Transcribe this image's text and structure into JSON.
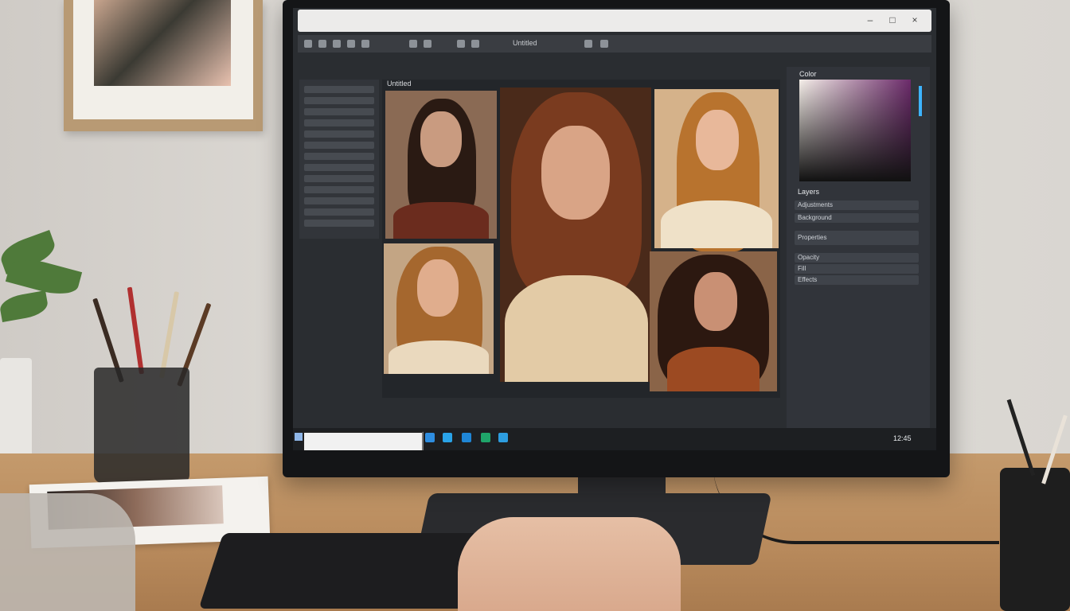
{
  "app": {
    "window_title": "",
    "toolbar_labels": [
      "Untitled"
    ],
    "tabs": [
      "Untitled"
    ]
  },
  "panels": {
    "color_panel_title": "Color",
    "layers_title": "Layers",
    "layer_rows": [
      "Adjustments",
      "Background",
      "Properties",
      "Opacity",
      "Fill",
      "Effects"
    ]
  },
  "taskbar": {
    "search_placeholder": "",
    "tray_text": "12:45"
  },
  "colors": {
    "accent": "#3db4ff",
    "panel": "#31343a",
    "canvas": "#23262a"
  },
  "photos": [
    {
      "position": "top-left",
      "tone": "dark hair portrait"
    },
    {
      "position": "center",
      "tone": "auburn wavy hair portrait"
    },
    {
      "position": "top-right",
      "tone": "blonde wavy hair portrait"
    },
    {
      "position": "bottom-left",
      "tone": "light brown wavy hair portrait"
    },
    {
      "position": "bottom-right",
      "tone": "dark curly hair portrait"
    }
  ]
}
